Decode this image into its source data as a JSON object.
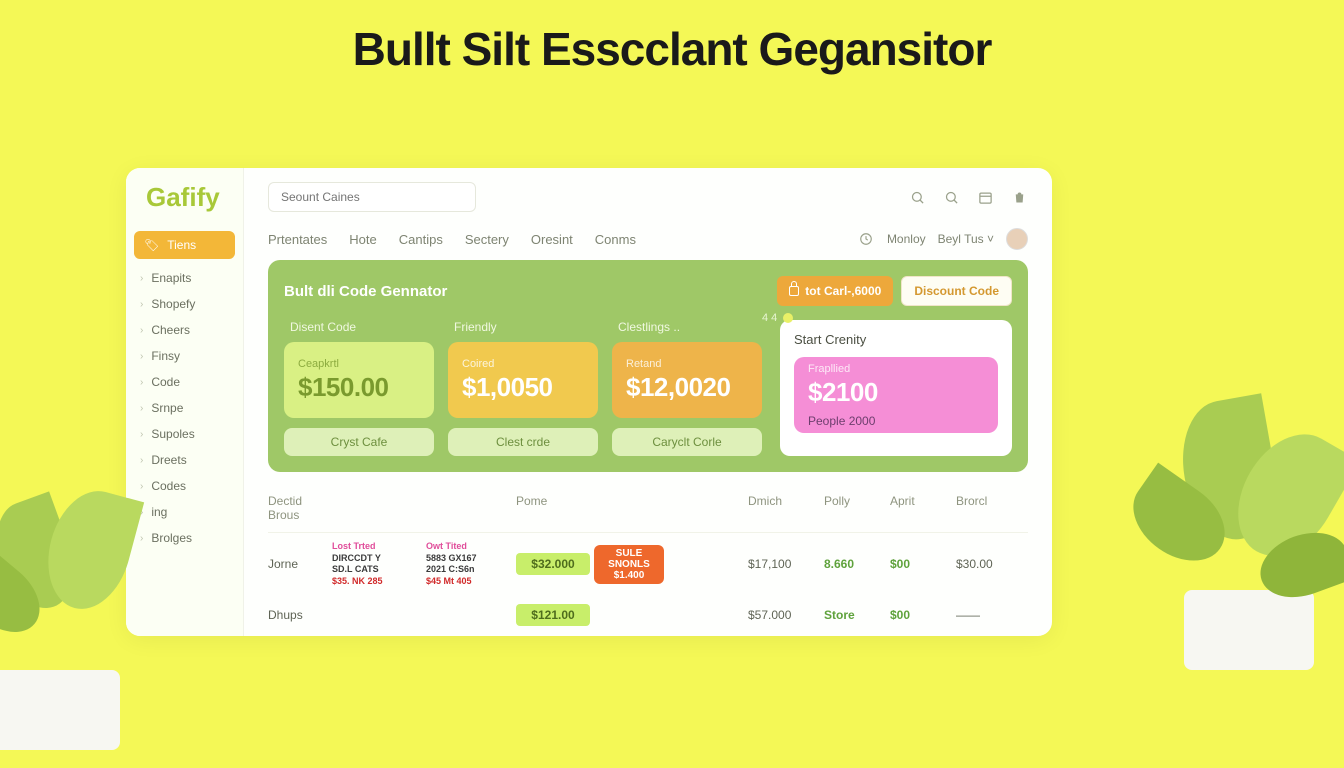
{
  "page_title": "Bullt Silt Esscclant Gegansitor",
  "brand": "Gafify",
  "search_placeholder": "Seount Caines",
  "sidebar": {
    "items": [
      {
        "label": "Tiens",
        "active": true
      },
      {
        "label": "Enapits"
      },
      {
        "label": "Shopefy"
      },
      {
        "label": "Cheers"
      },
      {
        "label": "Finsy"
      },
      {
        "label": "Code"
      },
      {
        "label": "Srnpe"
      },
      {
        "label": "Supoles"
      },
      {
        "label": "Dreets"
      },
      {
        "label": "Codes"
      },
      {
        "label": "ing"
      },
      {
        "label": "Brolges"
      }
    ]
  },
  "tabs": [
    "Prtentates",
    "Hote",
    "Cantips",
    "Sectery",
    "Oresint",
    "Conms"
  ],
  "user": {
    "monloy": "Monloy",
    "name": "Beyl Tus"
  },
  "panel": {
    "title": "Bult dli Code Gennator",
    "btn_lock": "tot Carl-,6000",
    "btn_discount": "Discount Code",
    "indicator": "4 4",
    "stats": [
      {
        "label": "Disent Code",
        "sub": "Ceapkrtl",
        "value": "$150.00",
        "foot": "Cryst Cafe",
        "box": "lime"
      },
      {
        "label": "Friendly",
        "sub": "Coired",
        "value": "$1,0050",
        "foot": "Clest crde",
        "box": "yellow"
      },
      {
        "label": "Clestlings ..",
        "sub": "Retand",
        "value": "$12,0020",
        "foot": "Caryclt Corle",
        "box": "orange"
      }
    ],
    "start": {
      "title": "Start Crenity",
      "sub": "Frapllied",
      "value": "$2100",
      "foot": "People 2000"
    }
  },
  "table": {
    "headers": [
      "Dectid Brous",
      "",
      "",
      "Pome",
      "",
      "Dmich",
      "Polly",
      "Aprit",
      "Brorcl"
    ],
    "rows": [
      {
        "name": "Jorne",
        "det1_head": "Lost Trted",
        "det1_l1": "DIRCCDT Y",
        "det1_l2": "SD.L CATS",
        "det1_l3": "$35. NK 285",
        "det2_head": "Owt Tited",
        "det2_l1": "5883 GX167",
        "det2_l2": "2021 C:S6n",
        "det2_l3": "$45 Mt 405",
        "pome": "$32.000",
        "badge_l1": "SULE",
        "badge_l2": "SNONLS",
        "badge_l3": "$1.400",
        "dmich": "$17,100",
        "polly": "8.660",
        "aprit": "$00",
        "brorcl": "$30.00"
      },
      {
        "name": "Dhups",
        "pome": "$121.00",
        "dmich": "$57.000",
        "polly": "Store",
        "aprit": "$00",
        "brorcl": "——"
      }
    ]
  }
}
